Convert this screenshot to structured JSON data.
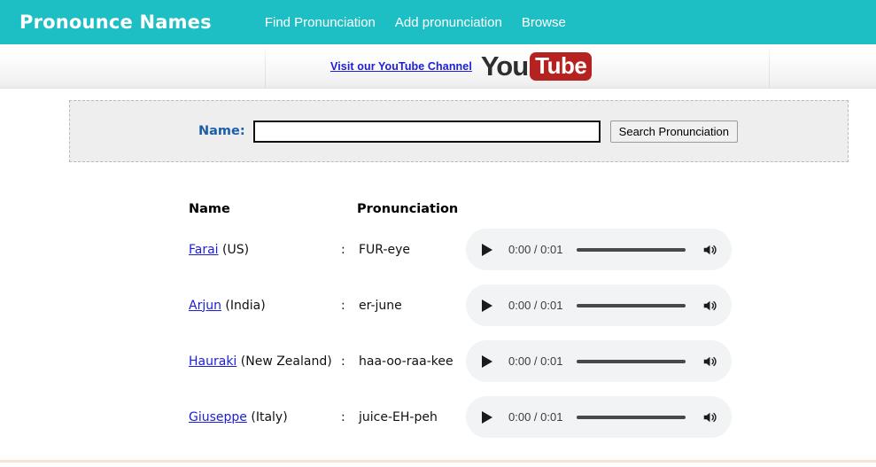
{
  "header": {
    "brand": "Pronounce Names",
    "nav": [
      {
        "label": "Find Pronunciation"
      },
      {
        "label": "Add pronunciation"
      },
      {
        "label": "Browse"
      }
    ]
  },
  "subheader": {
    "youtube_link": "Visit our YouTube Channel",
    "youtube_logo_you": "You",
    "youtube_logo_tube": "Tube"
  },
  "search": {
    "name_label": "Name:",
    "input_value": "",
    "input_placeholder": "",
    "button_label": "Search Pronunciation"
  },
  "table": {
    "columns": {
      "name": "Name",
      "pronunciation": "Pronunciation"
    },
    "rows": [
      {
        "name": "Farai",
        "region": "(US)",
        "separator": ":",
        "pronunciation": "FUR-eye",
        "player": {
          "time": "0:00 / 0:01",
          "play_icon": "play-icon",
          "volume_icon": "speaker-icon"
        }
      },
      {
        "name": "Arjun",
        "region": "(India)",
        "separator": ":",
        "pronunciation": "er-june",
        "player": {
          "time": "0:00 / 0:01",
          "play_icon": "play-icon",
          "volume_icon": "speaker-icon"
        }
      },
      {
        "name": "Hauraki",
        "region": "(New Zealand)",
        "separator": ":",
        "pronunciation": "haa-oo-raa-kee",
        "player": {
          "time": "0:00 / 0:01",
          "play_icon": "play-icon",
          "volume_icon": "speaker-icon"
        }
      },
      {
        "name": "Giuseppe",
        "region": "(Italy)",
        "separator": ":",
        "pronunciation": "juice-EH-peh",
        "player": {
          "time": "0:00 / 0:01",
          "play_icon": "play-icon",
          "volume_icon": "speaker-icon"
        }
      }
    ]
  },
  "colors": {
    "header_teal": "#1dbfc4",
    "link_blue": "#1e20d8",
    "label_blue": "#1c5fa8",
    "youtube_red": "#b5221f",
    "panel_gray": "#eeeeee",
    "player_gray": "#f1f3f4",
    "footer_rule": "#f6e5cf"
  }
}
